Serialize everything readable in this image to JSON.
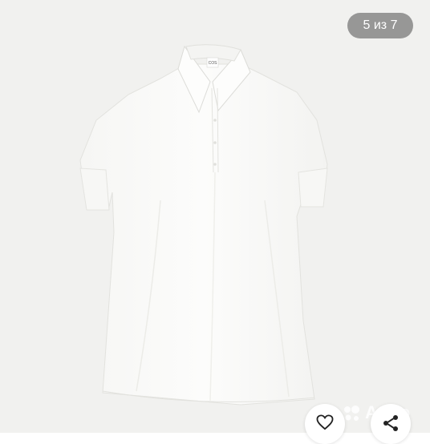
{
  "gallery": {
    "counter": "5 из 7",
    "product_brand_label": "COS",
    "watermark": "Avito"
  },
  "actions": {
    "favorite_icon": "heart-icon",
    "share_icon": "share-icon"
  },
  "colors": {
    "background": "#f1f1ef",
    "counter_bg": "#787878",
    "garment": "#fbfbfa"
  }
}
